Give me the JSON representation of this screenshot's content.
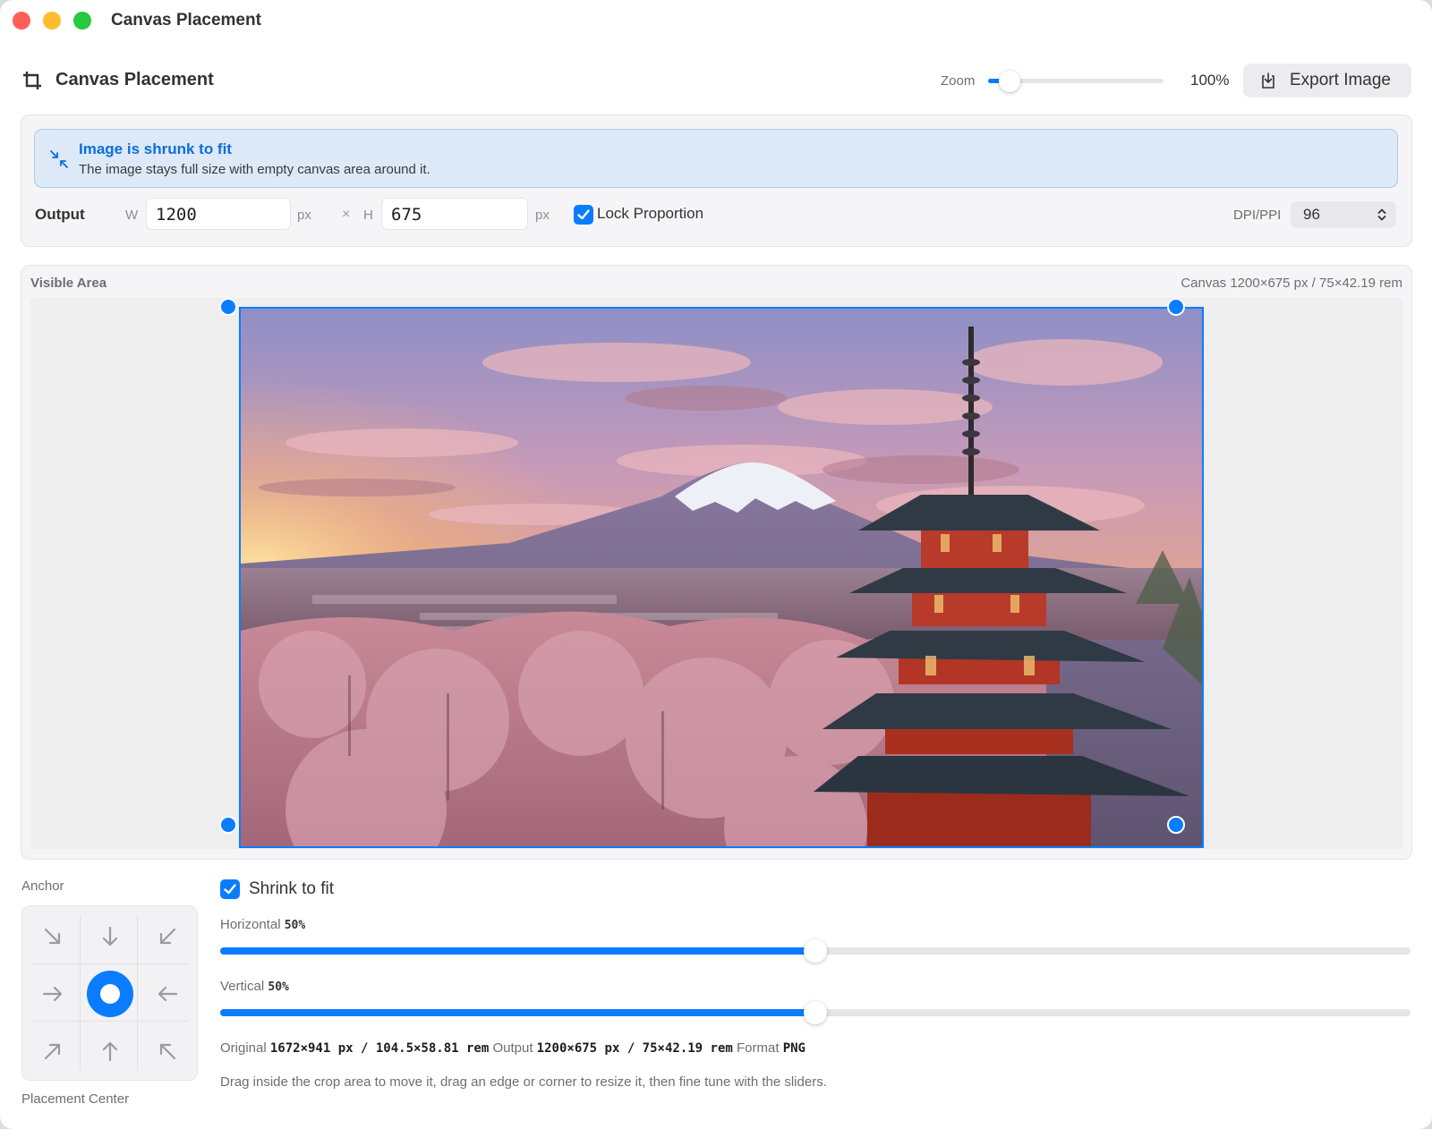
{
  "window": {
    "title": "Canvas Placement"
  },
  "header": {
    "title": "Canvas Placement",
    "zoom_label": "Zoom",
    "zoom_value": "100%",
    "zoom_fraction": 0.12,
    "export_label": "Export Image"
  },
  "banner": {
    "title": "Image is shrunk to fit",
    "subtitle": "The image stays full size with empty canvas area around it."
  },
  "output": {
    "label": "Output",
    "w_label": "W",
    "width": "1200",
    "h_label": "H",
    "height": "675",
    "unit": "px",
    "times": "×",
    "lock_label": "Lock Proportion",
    "lock_checked": true,
    "dpi_label": "DPI/PPI",
    "dpi_value": "96"
  },
  "visible_area": {
    "label": "Visible Area",
    "canvas_info": "Canvas 1200×675 px / 75×42.19 rem"
  },
  "anchor": {
    "label": "Anchor",
    "cells": [
      "arrow-down-right-icon",
      "arrow-down-icon",
      "arrow-down-left-icon",
      "arrow-right-icon",
      "center-dot-icon",
      "arrow-left-icon",
      "arrow-up-right-icon",
      "arrow-up-icon",
      "arrow-up-left-icon"
    ],
    "selected": "center",
    "footer": "Placement Center"
  },
  "controls": {
    "shrink_label": "Shrink to fit",
    "shrink_checked": true,
    "horizontal_label": "Horizontal",
    "horizontal_value": "50%",
    "horizontal_fraction": 0.5,
    "vertical_label": "Vertical",
    "vertical_value": "50%",
    "vertical_fraction": 0.5
  },
  "info": {
    "original_label": "Original",
    "original_value": "1672×941 px / 104.5×58.81 rem",
    "output_label": "Output",
    "output_value": "1200×675 px / 75×42.19 rem",
    "format_label": "Format",
    "format_value": "PNG",
    "hint": "Drag inside the crop area to move it, drag an edge or corner to resize it, then fine tune with the sliders."
  },
  "colors": {
    "accent": "#0a7cff",
    "banner_bg": "#dde9f6",
    "banner_text": "#0a6ede"
  }
}
